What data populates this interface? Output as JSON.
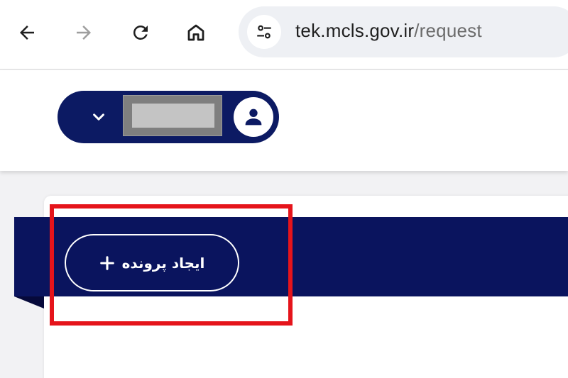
{
  "browser": {
    "url_host": "tek.mcls.gov.ir",
    "url_path": "/request",
    "icons": {
      "back": "arrow-left-icon",
      "forward": "arrow-right-icon",
      "reload": "reload-icon",
      "home": "home-icon",
      "site_info": "tune-icon"
    }
  },
  "header": {
    "user_menu": {
      "username": "",
      "chevron_icon": "chevron-down-icon",
      "avatar_icon": "user-icon"
    }
  },
  "main": {
    "create_button": {
      "label": "ایجاد پرونده",
      "icon": "plus-icon"
    }
  },
  "colors": {
    "brand_navy": "#0a145e",
    "highlight": "#e5141b"
  }
}
